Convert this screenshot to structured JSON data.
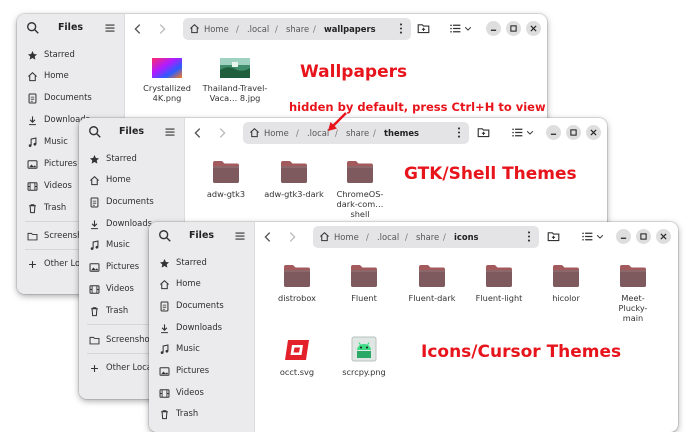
{
  "app_title": "Files",
  "colors": {
    "annotation": "#e8141b",
    "folder": "#7e5a5e",
    "folder_tab": "#a25a5c",
    "sidebar": "#ebebed"
  },
  "windows": {
    "w1": {
      "sidebar": [
        {
          "label": "Starred",
          "icon": "star-icon"
        },
        {
          "label": "Home",
          "icon": "home-icon"
        },
        {
          "label": "Documents",
          "icon": "document-icon"
        },
        {
          "label": "Downloads",
          "icon": "download-icon"
        },
        {
          "label": "Music",
          "icon": "music-icon"
        },
        {
          "label": "Pictures",
          "icon": "picture-icon"
        },
        {
          "label": "Videos",
          "icon": "video-icon"
        },
        {
          "label": "Trash",
          "icon": "trash-icon"
        },
        {
          "label": "Screenshots",
          "icon": "folder-icon"
        },
        {
          "label": "Other Locations",
          "icon": "plus-icon"
        }
      ],
      "path": [
        "Home",
        ".local",
        "share",
        "wallpapers"
      ],
      "files": [
        {
          "name": "Crystallized 4K.png"
        },
        {
          "name": "Thailand-Travel-Vaca… 8.jpg"
        }
      ]
    },
    "w2": {
      "sidebar": [
        {
          "label": "Starred",
          "icon": "star-icon"
        },
        {
          "label": "Home",
          "icon": "home-icon"
        },
        {
          "label": "Documents",
          "icon": "document-icon"
        },
        {
          "label": "Downloads",
          "icon": "download-icon"
        },
        {
          "label": "Music",
          "icon": "music-icon"
        },
        {
          "label": "Pictures",
          "icon": "picture-icon"
        },
        {
          "label": "Videos",
          "icon": "video-icon"
        },
        {
          "label": "Trash",
          "icon": "trash-icon"
        },
        {
          "label": "Screenshots",
          "icon": "folder-icon"
        },
        {
          "label": "Other Locations",
          "icon": "plus-icon"
        }
      ],
      "path": [
        "Home",
        ".local",
        "share",
        "themes"
      ],
      "files": [
        {
          "name": "adw-gtk3"
        },
        {
          "name": "adw-gtk3-dark"
        },
        {
          "name": "ChromeOS-dark-com… shell"
        }
      ]
    },
    "w3": {
      "sidebar": [
        {
          "label": "Starred",
          "icon": "star-icon"
        },
        {
          "label": "Home",
          "icon": "home-icon"
        },
        {
          "label": "Documents",
          "icon": "document-icon"
        },
        {
          "label": "Downloads",
          "icon": "download-icon"
        },
        {
          "label": "Music",
          "icon": "music-icon"
        },
        {
          "label": "Pictures",
          "icon": "picture-icon"
        },
        {
          "label": "Videos",
          "icon": "video-icon"
        },
        {
          "label": "Trash",
          "icon": "trash-icon"
        }
      ],
      "path": [
        "Home",
        ".local",
        "share",
        "icons"
      ],
      "files": [
        {
          "name": "distrobox"
        },
        {
          "name": "Fluent"
        },
        {
          "name": "Fluent-dark"
        },
        {
          "name": "Fluent-light"
        },
        {
          "name": "hicolor"
        },
        {
          "name": "Meet-Plucky-main"
        },
        {
          "name": "occt.svg"
        },
        {
          "name": "scrcpy.png"
        }
      ]
    }
  },
  "annotations": {
    "wallpapers": "Wallpapers",
    "hidden_note": "hidden by default, press Ctrl+H to view",
    "themes": "GTK/Shell Themes",
    "icons": "Icons/Cursor Themes"
  }
}
